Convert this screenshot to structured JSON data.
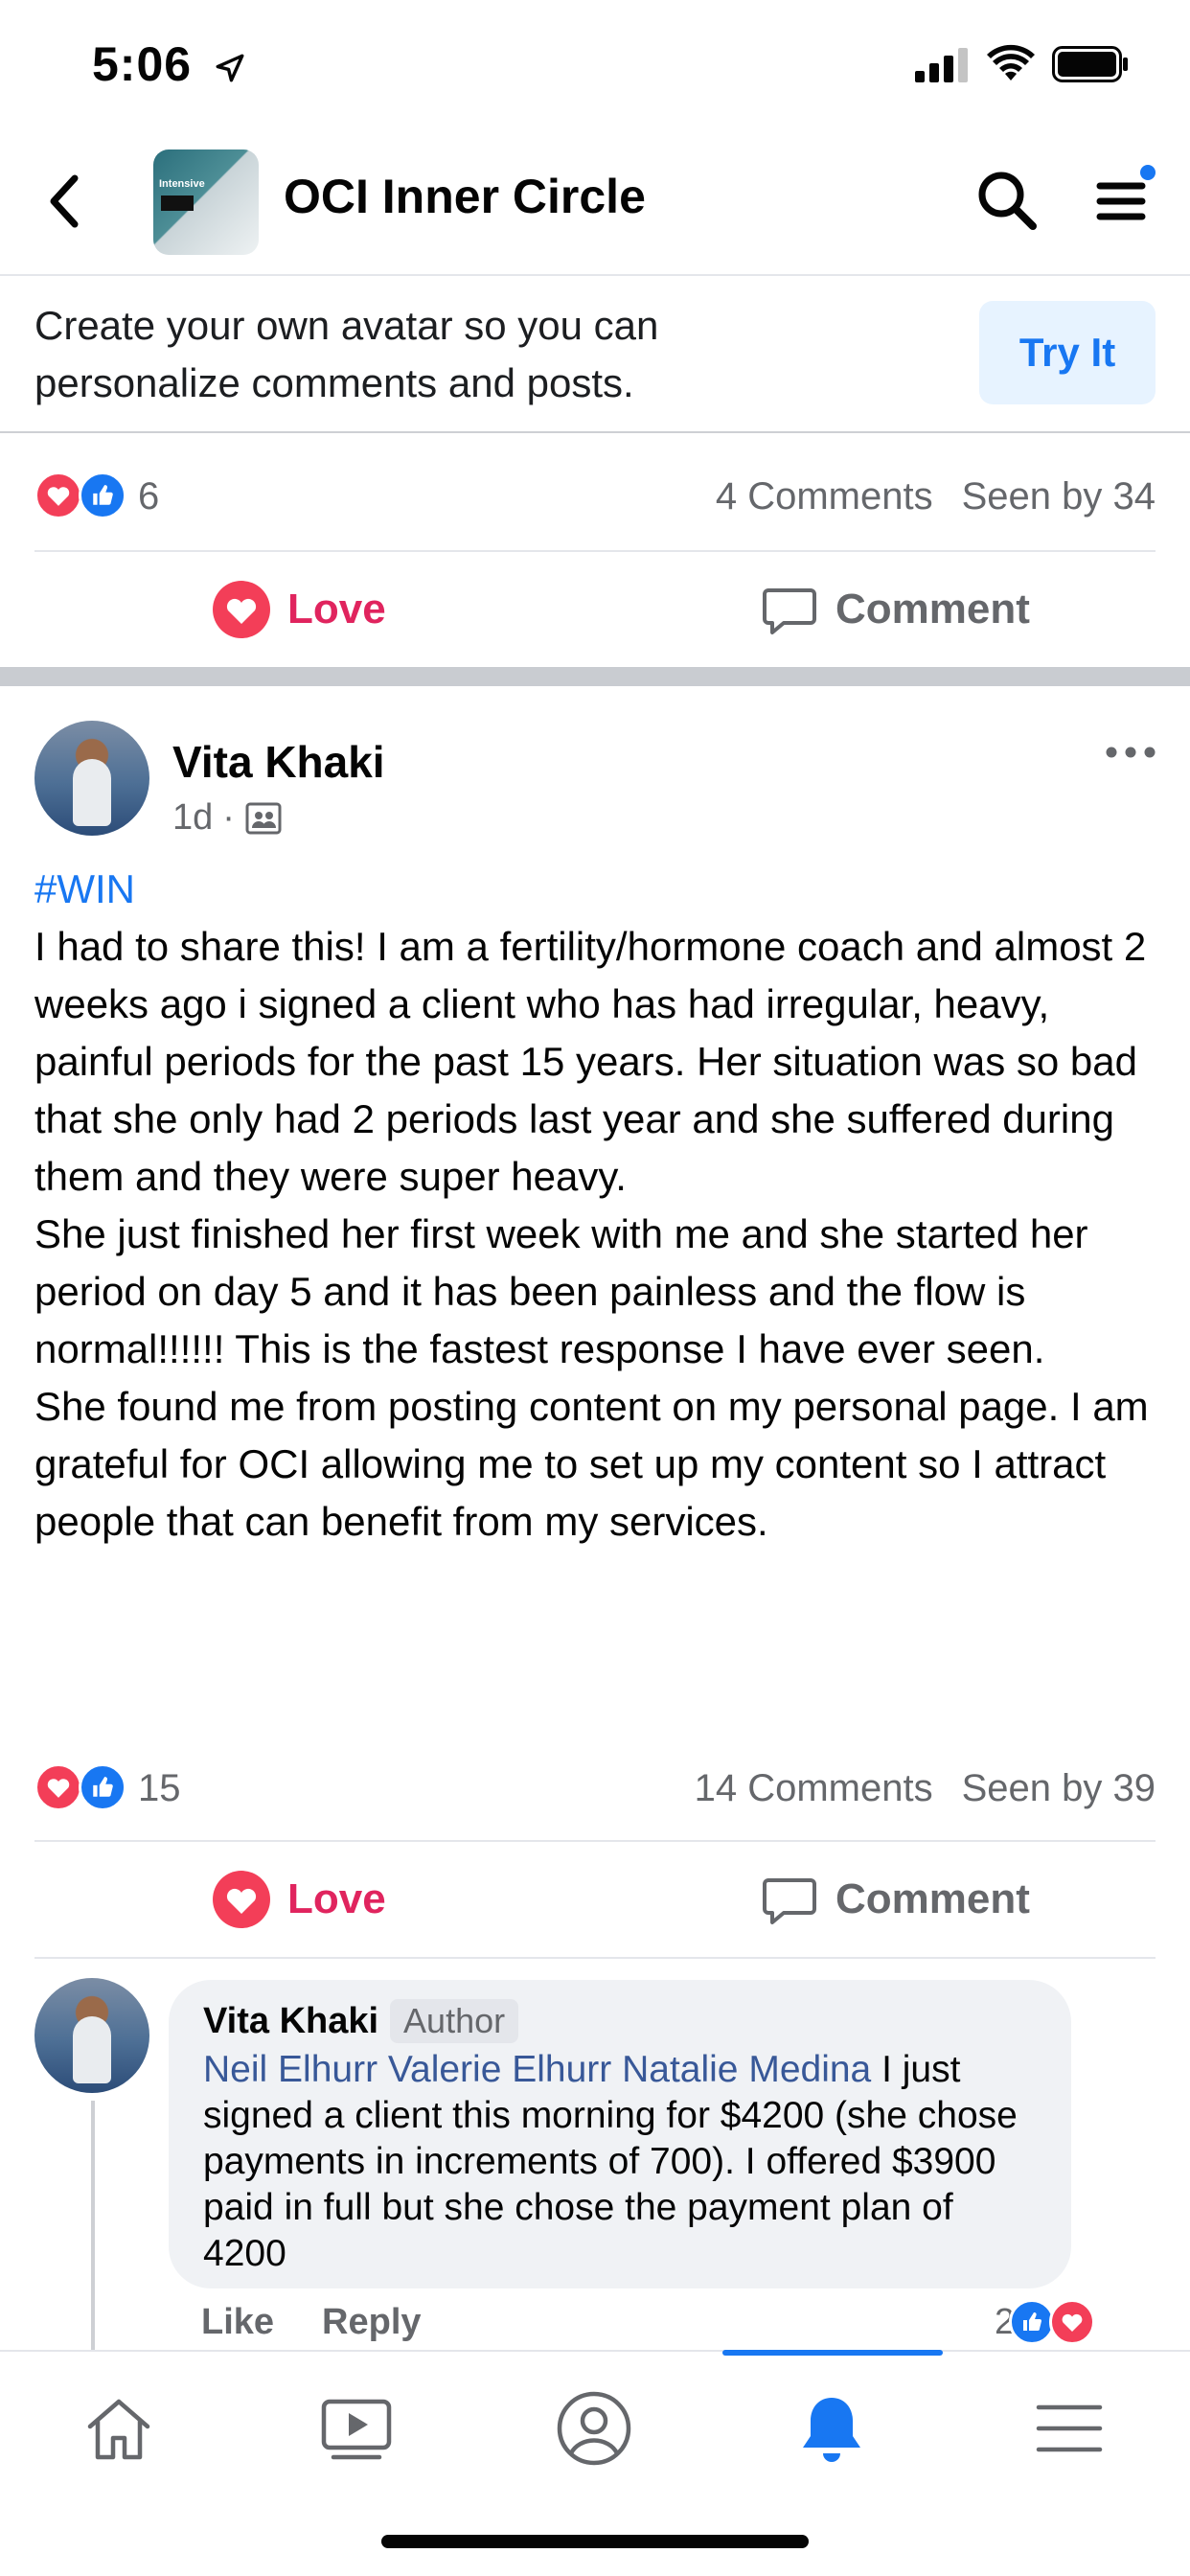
{
  "status_bar": {
    "time": "5:06"
  },
  "header": {
    "title": "OCI Inner Circle",
    "thumb_label": "Intensive"
  },
  "promo": {
    "text": "Create your own avatar so you can personalize comments and posts.",
    "button": "Try It"
  },
  "prev_post": {
    "reaction_count": "6",
    "comments": "4 Comments",
    "seen": "Seen by 34",
    "love_label": "Love",
    "comment_label": "Comment"
  },
  "post": {
    "author": "Vita Khaki",
    "time": "1d",
    "hashtag": "#WIN",
    "paragraphs": [
      "I had to share this! I am a fertility/hormone coach and almost 2 weeks ago i signed a client who has had irregular, heavy, painful periods for the past 15 years. Her situation was so bad that she only had 2 periods last year and she suffered during them and they were super heavy.",
      "She just finished her first week with me and she started her period on day 5 and it has been painless and the flow is normal!!!!!! This is the fastest response I have ever seen.",
      "She found me from posting content on my personal page. I am grateful for OCI allowing me to set up my content so I attract people that can benefit from my services."
    ],
    "reaction_count": "15",
    "comments": "14 Comments",
    "seen": "Seen by 39",
    "love_label": "Love",
    "comment_label": "Comment"
  },
  "comment": {
    "author": "Vita Khaki",
    "badge": "Author",
    "mentions": "Neil Elhurr Valerie Elhurr Natalie Medina",
    "text": " I just signed a client this morning for $4200 (she chose payments in increments of 700). I offered $3900 paid in full but she chose the payment plan of 4200",
    "like_label": "Like",
    "reply_label": "Reply",
    "reaction_count": "2"
  },
  "colors": {
    "accent": "#1877f2",
    "love": "#e0245e",
    "secondary_text": "#65676b"
  }
}
